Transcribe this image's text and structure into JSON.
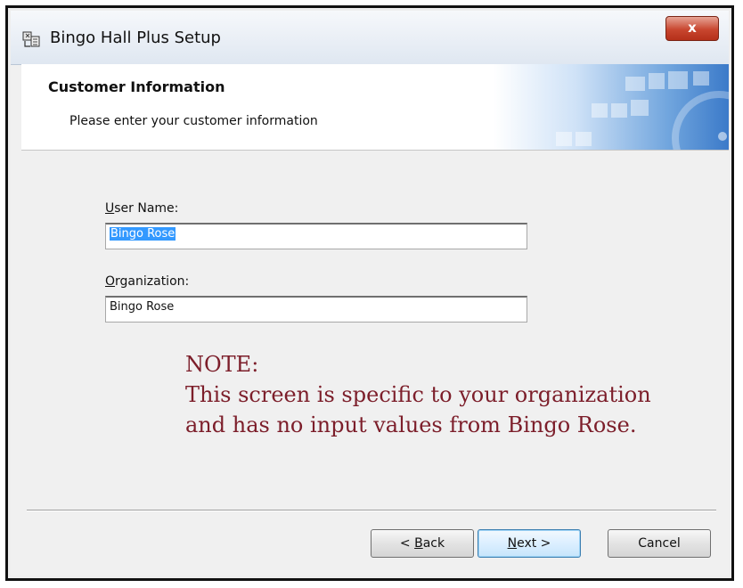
{
  "window": {
    "title": "Bingo Hall Plus Setup",
    "close_label": "x"
  },
  "banner": {
    "title": "Customer Information",
    "subtitle": "Please enter your customer information"
  },
  "form": {
    "username_label_accel": "U",
    "username_label_rest": "ser Name:",
    "username_value": "Bingo Rose",
    "organization_label_accel": "O",
    "organization_label_rest": "rganization:",
    "organization_value": "Bingo Rose"
  },
  "note": {
    "line1": "NOTE:",
    "line2": "This screen is specific to your organization",
    "line3": "and has no input values from Bingo Rose."
  },
  "buttons": {
    "back_prefix": "< ",
    "back_accel": "B",
    "back_rest": "ack",
    "next_accel": "N",
    "next_rest": "ext >",
    "cancel": "Cancel"
  },
  "colors": {
    "note_text": "#7c1e2a",
    "selection": "#3399ff",
    "close_button": "#c8462f"
  },
  "icons": [
    "installer-icon",
    "close-icon"
  ]
}
